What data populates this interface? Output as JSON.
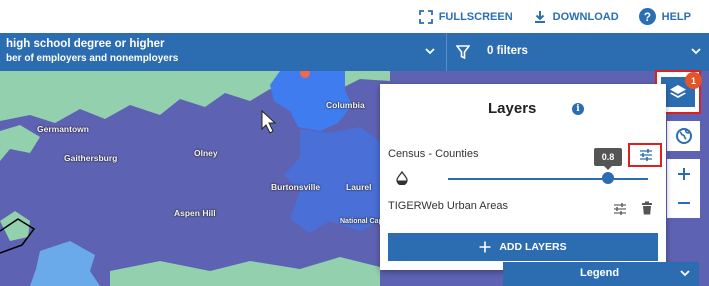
{
  "toolbar": {
    "fullscreen_label": "FULLSCREEN",
    "download_label": "DOWNLOAD",
    "help_label": "HELP"
  },
  "filterbar": {
    "variable_title": "high school degree or higher",
    "variable_subtitle": "ber of employers and nonemployers",
    "filters_label": "0 filters"
  },
  "map": {
    "places": [
      "Germantown",
      "Gaithersburg",
      "Olney",
      "Columbia",
      "Burtonsville",
      "Laurel",
      "Aspen Hill",
      "National Capital R"
    ],
    "colors": {
      "dark_purple": "#5e62b2",
      "light_green": "#93d0ad",
      "mid_blue": "#4a6fd6",
      "bright_blue": "#3f7cf0"
    }
  },
  "layers_control": {
    "badge_count": "1"
  },
  "panel": {
    "title": "Layers",
    "info_glyph": "i",
    "layers": [
      {
        "name": "Census - Counties",
        "opacity": 0.8,
        "opacity_label": "0.8"
      },
      {
        "name": "TIGERWeb Urban Areas"
      }
    ],
    "add_layers_label": "ADD LAYERS"
  },
  "legend": {
    "label": "Legend"
  },
  "colors": {
    "accent_blue": "#2c6db1",
    "highlight_red": "#e0201f",
    "badge_orange": "#e2542a"
  }
}
